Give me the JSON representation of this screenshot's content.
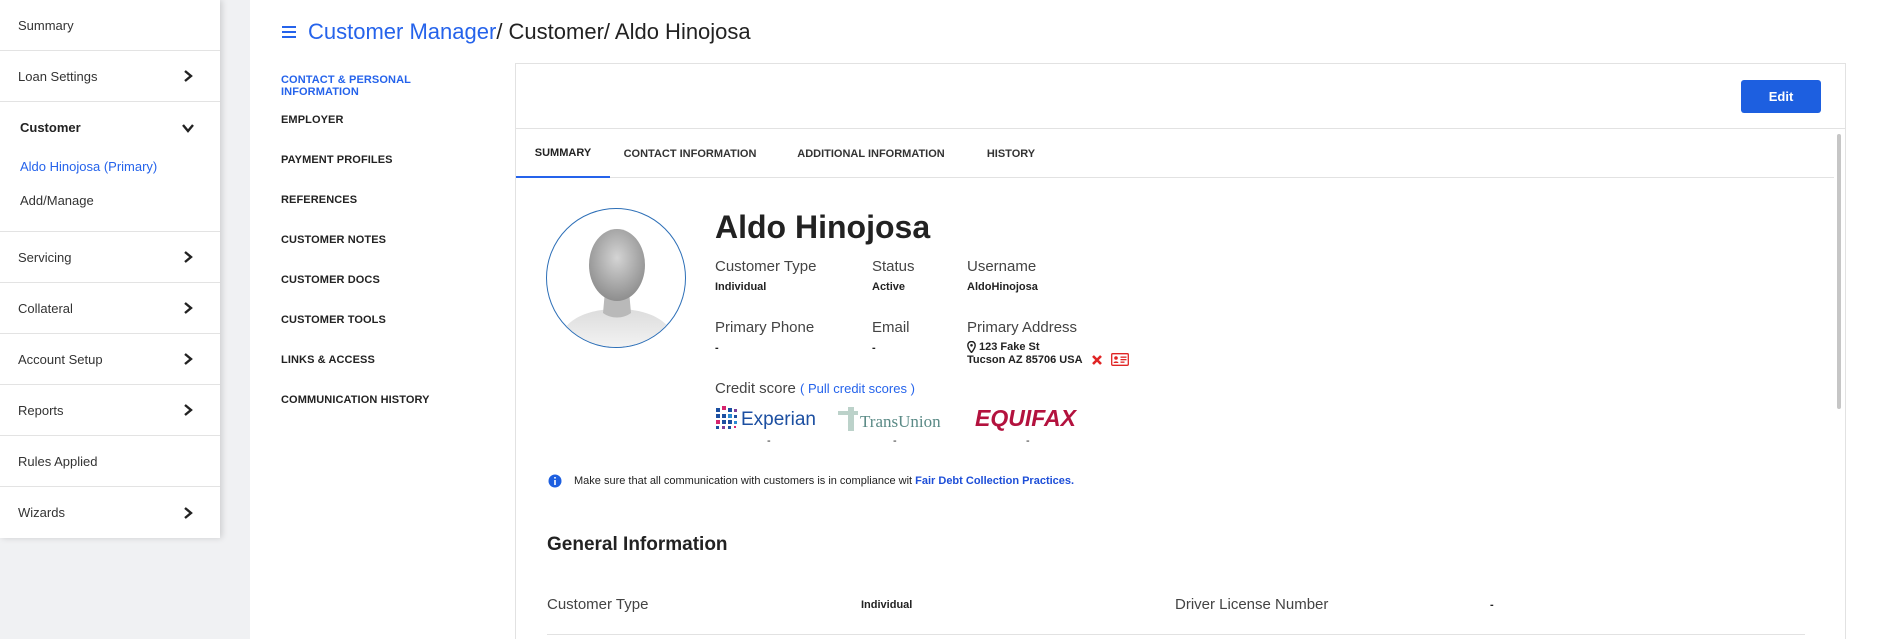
{
  "sidebar": {
    "items": [
      {
        "label": "Summary",
        "has_chevron": false
      },
      {
        "label": "Loan Settings",
        "has_chevron": true
      },
      {
        "label": "Servicing",
        "has_chevron": true
      },
      {
        "label": "Collateral",
        "has_chevron": true
      },
      {
        "label": "Account Setup",
        "has_chevron": true
      },
      {
        "label": "Reports",
        "has_chevron": true
      },
      {
        "label": "Rules Applied",
        "has_chevron": false
      },
      {
        "label": "Wizards",
        "has_chevron": true
      }
    ],
    "expanded": {
      "label": "Customer",
      "children": [
        "Aldo Hinojosa (Primary)",
        "Add/Manage"
      ]
    }
  },
  "breadcrumb": {
    "root": "Customer Manager",
    "rest": "/ Customer/ Aldo Hinojosa"
  },
  "subnav": {
    "items": [
      "CONTACT & PERSONAL INFORMATION",
      "EMPLOYER",
      "PAYMENT PROFILES",
      "REFERENCES",
      "CUSTOMER NOTES",
      "CUSTOMER DOCS",
      "CUSTOMER TOOLS",
      "LINKS & ACCESS",
      "COMMUNICATION HISTORY"
    ],
    "active_index": 0
  },
  "toolbar": {
    "edit_label": "Edit"
  },
  "tabs": {
    "items": [
      "SUMMARY",
      "CONTACT INFORMATION",
      "ADDITIONAL INFORMATION",
      "HISTORY"
    ],
    "active_index": 0
  },
  "customer": {
    "name": "Aldo Hinojosa",
    "type_label": "Customer Type",
    "type_value": "Individual",
    "status_label": "Status",
    "status_value": "Active",
    "username_label": "Username",
    "username_value": "AldoHinojosa",
    "phone_label": "Primary Phone",
    "phone_value": "-",
    "email_label": "Email",
    "email_value": "-",
    "address_label": "Primary Address",
    "address_line1": "123 Fake St",
    "address_line2": "Tucson AZ 85706 USA"
  },
  "credit": {
    "label": "Credit score",
    "pull_link": "( Pull credit scores )",
    "bureaus": [
      {
        "name": "Experian",
        "score": "-"
      },
      {
        "name": "TransUnion",
        "score": "-"
      },
      {
        "name": "EQUIFAX",
        "score": "-"
      }
    ]
  },
  "notice": {
    "text": "Make sure that all communication with customers is in compliance wit",
    "link": "Fair Debt Collection Practices."
  },
  "general": {
    "title": "General Information",
    "row": {
      "label1": "Customer Type",
      "value1": "Individual",
      "label2": "Driver License Number",
      "value2": "-"
    }
  },
  "colors": {
    "accent": "#2563eb",
    "button": "#1d5fe0",
    "danger": "#e02424",
    "equifax": "#b3123e",
    "experian": "#1c4fa1",
    "transunion": "#5a8a86"
  }
}
